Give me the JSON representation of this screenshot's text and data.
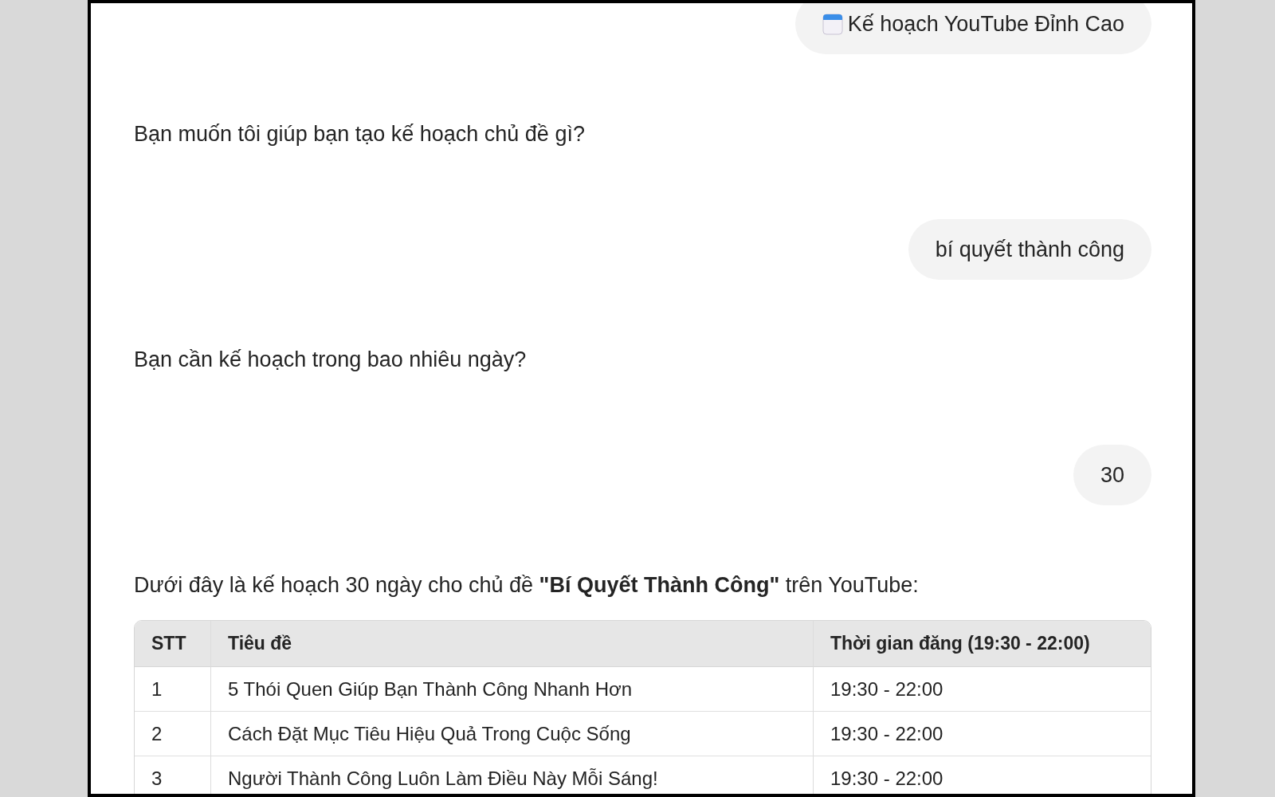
{
  "messages": [
    {
      "kind": "user",
      "has_icon": true,
      "text": "Kế hoạch YouTube Đỉnh Cao"
    },
    {
      "kind": "assistant",
      "text": "Bạn muốn tôi giúp bạn tạo kế hoạch chủ đề gì?"
    },
    {
      "kind": "user",
      "text": "bí quyết thành công"
    },
    {
      "kind": "assistant",
      "text": "Bạn cần kế hoạch trong bao nhiêu ngày?"
    },
    {
      "kind": "user",
      "text": "30"
    },
    {
      "kind": "assistant",
      "text": "Dưới đây là kế hoạch 30 ngày cho chủ đề **\"Bí Quyết Thành Công\"** trên YouTube:",
      "table": {
        "columns": [
          "STT",
          "Tiêu đề",
          "Thời gian đăng (19:30 - 22:00)"
        ],
        "rows": [
          [
            "1",
            "5 Thói Quen Giúp Bạn Thành Công Nhanh Hơn",
            "19:30 - 22:00"
          ],
          [
            "2",
            "Cách Đặt Mục Tiêu Hiệu Quả Trong Cuộc Sống",
            "19:30 - 22:00"
          ],
          [
            "3",
            "Người Thành Công Luôn Làm Điều Này Mỗi Sáng!",
            "19:30 - 22:00"
          ]
        ]
      }
    }
  ]
}
